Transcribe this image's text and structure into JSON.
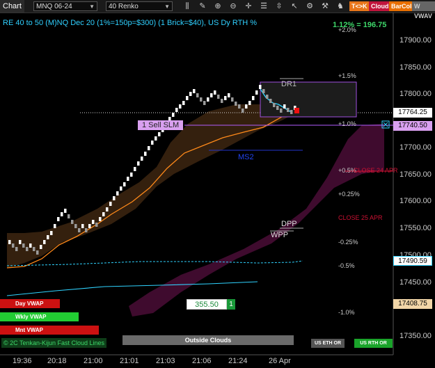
{
  "toolbar": {
    "tab_label": "Chart",
    "instrument": "MNQ 06-24",
    "bar_type": "40 Renko",
    "btn_tk": "T<>K",
    "btn_cloud": "Cloud",
    "btn_barcol": "BarCol",
    "btn_w": "W VWAV"
  },
  "chart": {
    "title": "RE 40 to 50 (M)NQ Dec 20 (1%=150p=$300) (1 Brick=$40), US Dy RTH %",
    "pct_top": "1.12% = 196.75",
    "pct_plus2": "+2.0%",
    "dr1": "DR1",
    "pct_plus15": "+1.5%",
    "pct_plus1": "+1.0%",
    "sell_label": "1 Sell SLM",
    "ms2": "MS2",
    "pct_plus05": "+0.5%",
    "close24": "CLOSE 24 APR",
    "pct_plus025": "+0.25%",
    "close25": "CLOSE 25 APR",
    "dpp": "DPP",
    "wpp": "WPP",
    "pct_minus025": "-0.25%",
    "pct_minus05": "-0.5%",
    "pct_minus1": "-1.0%",
    "box_value": "355.50",
    "box_count": "1"
  },
  "price_axis": {
    "ticks": [
      "17900.00",
      "17850.00",
      "17800.00",
      "17750.00",
      "17700.00",
      "17650.00",
      "17600.00",
      "17550.00",
      "17500.00",
      "17450.00",
      "17400.00",
      "17350.00"
    ],
    "last": "17764.25",
    "sell": "17740.50",
    "vwap": "17490.59",
    "close": "17408.75"
  },
  "time_axis": [
    "19:36",
    "20:18",
    "21:00",
    "21:01",
    "21:03",
    "21:06",
    "21:24",
    "26 Apr"
  ],
  "legend": {
    "day_vwap": "Day VWAP",
    "wkly_vwap": "Wkly VWAP",
    "mnt_vwap": "Mnt VWAP",
    "tenkan": "© 2C Tenkan-Kijun Fast Cloud Lines",
    "outside": "Outside Clouds",
    "us_eth": "US ETH OR",
    "us_rth": "US RTH OR"
  },
  "colors": {
    "cyan": "#2fd3ff",
    "orange": "#ff8a1a",
    "purple": "#b25cff",
    "magenta": "#5a1040",
    "red": "#e11",
    "green": "#2ecc40"
  }
}
